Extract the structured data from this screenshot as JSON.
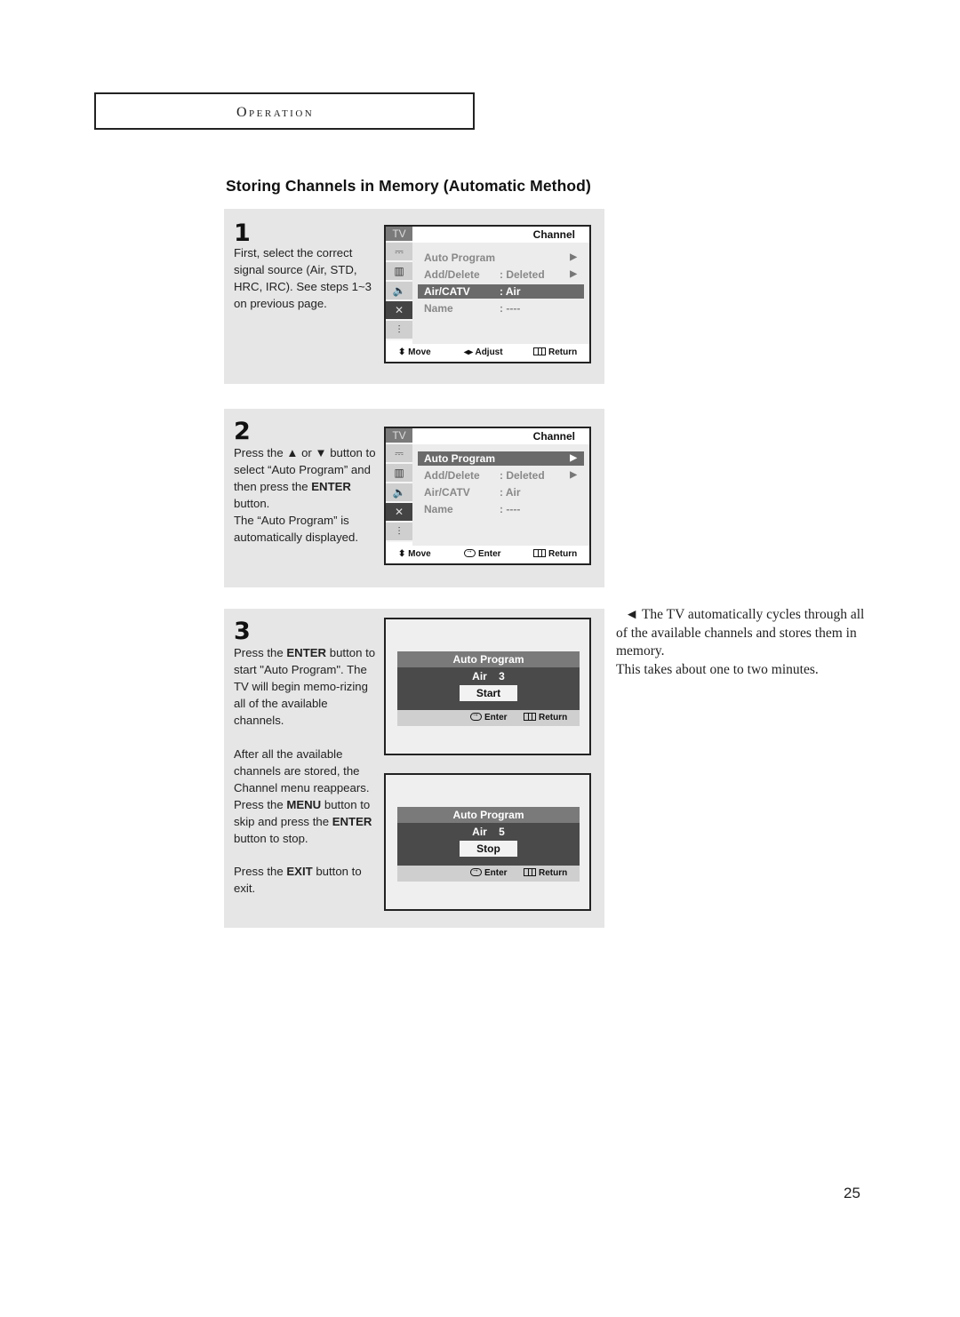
{
  "header": {
    "section": "Operation"
  },
  "title": "Storing Channels in Memory (Automatic Method)",
  "steps": [
    {
      "number": "1",
      "text": "First, select the correct signal source (Air, STD, HRC, IRC). See steps 1~3 on previous page.",
      "osd": {
        "tab": "TV",
        "heading": "Channel",
        "rows": [
          {
            "label": "Auto Program",
            "value": "",
            "arrow": "▶"
          },
          {
            "label": "Add/Delete",
            "value": ":  Deleted",
            "arrow": "▶"
          },
          {
            "label": "Air/CATV",
            "value": ":  Air",
            "arrow": ""
          },
          {
            "label": "Name",
            "value": ":  ----",
            "arrow": ""
          }
        ],
        "selected_row": 2,
        "footer": [
          "Move",
          "Adjust",
          "Return"
        ]
      }
    },
    {
      "number": "2",
      "text_parts": [
        "Press the ",
        "▲",
        " or ",
        "▼",
        " button to select “Auto Program” and then press the ",
        "ENTER",
        " button.",
        "The “Auto Program” is automatically displayed."
      ],
      "osd": {
        "tab": "TV",
        "heading": "Channel",
        "rows": [
          {
            "label": "Auto Program",
            "value": "",
            "arrow": "▶"
          },
          {
            "label": "Add/Delete",
            "value": ":  Deleted",
            "arrow": "▶"
          },
          {
            "label": "Air/CATV",
            "value": ":  Air",
            "arrow": ""
          },
          {
            "label": "Name",
            "value": ":  ----",
            "arrow": ""
          }
        ],
        "selected_row": 0,
        "footer": [
          "Move",
          "Enter",
          "Return"
        ]
      }
    },
    {
      "number": "3",
      "para1": [
        "Press the ",
        "ENTER",
        " button to start \"Auto Program\". The TV will begin memo-rizing all of the available channels."
      ],
      "para2": [
        "After all the available channels are stored, the Channel menu reappears. Press the ",
        "MENU",
        " button to skip and press the ",
        "ENTER",
        " button to stop."
      ],
      "para3": [
        "Press the ",
        "EXIT",
        " button to exit."
      ],
      "screens": [
        {
          "heading": "Auto Program",
          "channel": "Air    3",
          "button": "Start",
          "footer": [
            "Enter",
            "Return"
          ]
        },
        {
          "heading": "Auto Program",
          "channel": "Air    5",
          "button": "Stop",
          "footer": [
            "Enter",
            "Return"
          ]
        }
      ]
    }
  ],
  "side_note": {
    "arrow": "◄",
    "line1": " The TV automatically cycles through all of the available channels and stores them in memory.",
    "line2": "This takes about one to two minutes."
  },
  "page_number": "25"
}
